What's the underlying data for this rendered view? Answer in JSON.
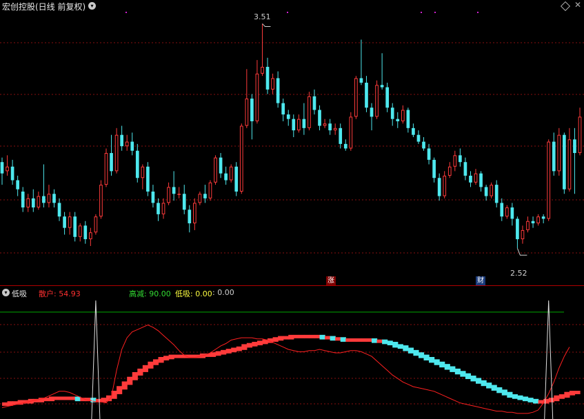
{
  "header": {
    "title": "宏创控股(日线 前复权)",
    "toggle_icon": "chevron-down-icon",
    "right_icons": [
      "diamond-icon",
      "close-icon"
    ],
    "close_glyph": "✕"
  },
  "main_chart": {
    "high_label": "3.51",
    "low_label": "2.52",
    "marker_up": "涨",
    "marker_fin": "财"
  },
  "indicator": {
    "name": "低吸",
    "items": [
      {
        "label": "散户: ",
        "value": "54.93",
        "color": "#ff3030"
      },
      {
        "label": "高减: ",
        "value": "90.00",
        "color": "#33dd33"
      },
      {
        "label": "低吸: ",
        "value": "0.00",
        "color": "#ffff40"
      },
      {
        "label": " : ",
        "value": "0.00",
        "color": "#cfcfcf"
      }
    ]
  },
  "colors": {
    "up": "#ff3b3b",
    "down": "#4ee8ee",
    "grid": "#8a1010",
    "divider": "#b00000",
    "green_line": "#00aa00",
    "white_line": "#e0e0e0",
    "red_line": "#ff2020"
  },
  "chart_data": {
    "type": "candlestick",
    "price_range": [
      2.46,
      3.56
    ],
    "candles": [
      [
        2.9,
        2.85,
        2.92,
        2.8
      ],
      [
        2.86,
        2.88,
        2.93,
        2.84
      ],
      [
        2.88,
        2.82,
        2.91,
        2.8
      ],
      [
        2.82,
        2.78,
        2.84,
        2.75
      ],
      [
        2.77,
        2.7,
        2.79,
        2.68
      ],
      [
        2.7,
        2.74,
        2.76,
        2.68
      ],
      [
        2.74,
        2.7,
        2.78,
        2.68
      ],
      [
        2.7,
        2.75,
        2.77,
        2.69
      ],
      [
        2.75,
        2.72,
        2.89,
        2.7
      ],
      [
        2.72,
        2.76,
        2.8,
        2.7
      ],
      [
        2.76,
        2.72,
        2.78,
        2.7
      ],
      [
        2.72,
        2.66,
        2.74,
        2.64
      ],
      [
        2.66,
        2.61,
        2.68,
        2.58
      ],
      [
        2.61,
        2.66,
        2.68,
        2.58
      ],
      [
        2.66,
        2.57,
        2.68,
        2.55
      ],
      [
        2.57,
        2.62,
        2.63,
        2.55
      ],
      [
        2.62,
        2.56,
        2.64,
        2.54
      ],
      [
        2.56,
        2.59,
        2.61,
        2.53
      ],
      [
        2.59,
        2.66,
        2.67,
        2.58
      ],
      [
        2.66,
        2.8,
        2.82,
        2.65
      ],
      [
        2.8,
        2.94,
        2.96,
        2.79
      ],
      [
        2.94,
        2.86,
        3.02,
        2.84
      ],
      [
        2.86,
        3.02,
        3.05,
        2.85
      ],
      [
        3.02,
        2.97,
        3.06,
        2.95
      ],
      [
        2.97,
        2.99,
        3.02,
        2.95
      ],
      [
        2.99,
        2.95,
        3.03,
        2.93
      ],
      [
        2.95,
        2.83,
        2.98,
        2.81
      ],
      [
        2.83,
        2.88,
        2.89,
        2.78
      ],
      [
        2.88,
        2.77,
        2.9,
        2.75
      ],
      [
        2.77,
        2.72,
        2.8,
        2.7
      ],
      [
        2.72,
        2.67,
        2.74,
        2.64
      ],
      [
        2.67,
        2.72,
        2.74,
        2.65
      ],
      [
        2.72,
        2.79,
        2.81,
        2.71
      ],
      [
        2.79,
        2.76,
        2.86,
        2.73
      ],
      [
        2.76,
        2.76,
        2.79,
        2.74
      ],
      [
        2.76,
        2.69,
        2.8,
        2.67
      ],
      [
        2.69,
        2.63,
        2.71,
        2.59
      ],
      [
        2.63,
        2.72,
        2.74,
        2.6
      ],
      [
        2.72,
        2.76,
        2.77,
        2.71
      ],
      [
        2.76,
        2.74,
        2.8,
        2.72
      ],
      [
        2.74,
        2.81,
        2.82,
        2.73
      ],
      [
        2.81,
        2.92,
        2.93,
        2.8
      ],
      [
        2.92,
        2.85,
        2.94,
        2.83
      ],
      [
        2.85,
        2.82,
        2.88,
        2.8
      ],
      [
        2.82,
        2.88,
        2.89,
        2.81
      ],
      [
        2.88,
        2.77,
        2.9,
        2.75
      ],
      [
        2.77,
        3.06,
        3.07,
        2.76
      ],
      [
        3.06,
        3.18,
        3.31,
        3.05
      ],
      [
        3.18,
        3.08,
        3.2,
        3.0
      ],
      [
        3.08,
        3.29,
        3.35,
        3.07
      ],
      [
        3.29,
        3.32,
        3.51,
        3.28
      ],
      [
        3.32,
        3.22,
        3.36,
        3.2
      ],
      [
        3.22,
        3.27,
        3.29,
        3.2
      ],
      [
        3.27,
        3.16,
        3.3,
        3.14
      ],
      [
        3.16,
        3.11,
        3.18,
        3.08
      ],
      [
        3.11,
        3.09,
        3.13,
        3.06
      ],
      [
        3.09,
        3.04,
        3.11,
        3.01
      ],
      [
        3.04,
        3.09,
        3.11,
        3.03
      ],
      [
        3.09,
        3.05,
        3.16,
        3.02
      ],
      [
        3.05,
        3.19,
        3.21,
        3.04
      ],
      [
        3.19,
        3.13,
        3.22,
        3.11
      ],
      [
        3.13,
        3.06,
        3.15,
        3.04
      ],
      [
        3.06,
        3.07,
        3.09,
        3.05
      ],
      [
        3.07,
        3.04,
        3.09,
        3.02
      ],
      [
        3.04,
        3.05,
        3.07,
        3.02
      ],
      [
        3.05,
        2.98,
        3.07,
        2.96
      ],
      [
        2.98,
        2.96,
        3.0,
        2.95
      ],
      [
        2.96,
        3.1,
        3.12,
        2.95
      ],
      [
        3.1,
        3.27,
        3.28,
        3.09
      ],
      [
        3.27,
        3.25,
        3.44,
        3.24
      ],
      [
        3.25,
        3.14,
        3.28,
        3.12
      ],
      [
        3.14,
        3.1,
        3.16,
        3.04
      ],
      [
        3.1,
        3.24,
        3.26,
        3.09
      ],
      [
        3.24,
        3.23,
        3.38,
        3.22
      ],
      [
        3.23,
        3.14,
        3.25,
        3.12
      ],
      [
        3.14,
        3.09,
        3.16,
        3.06
      ],
      [
        3.09,
        3.08,
        3.12,
        3.05
      ],
      [
        3.08,
        3.13,
        3.15,
        3.07
      ],
      [
        3.13,
        3.05,
        3.14,
        3.03
      ],
      [
        3.05,
        3.02,
        3.07,
        3.01
      ],
      [
        3.02,
        2.99,
        3.04,
        2.98
      ],
      [
        2.99,
        2.96,
        3.01,
        2.95
      ],
      [
        2.96,
        2.91,
        2.98,
        2.89
      ],
      [
        2.91,
        2.83,
        2.92,
        2.81
      ],
      [
        2.83,
        2.75,
        2.85,
        2.73
      ],
      [
        2.75,
        2.84,
        2.86,
        2.74
      ],
      [
        2.84,
        2.88,
        2.9,
        2.83
      ],
      [
        2.88,
        2.93,
        2.95,
        2.86
      ],
      [
        2.93,
        2.9,
        2.96,
        2.88
      ],
      [
        2.9,
        2.84,
        2.92,
        2.82
      ],
      [
        2.84,
        2.81,
        2.86,
        2.79
      ],
      [
        2.81,
        2.85,
        2.87,
        2.8
      ],
      [
        2.85,
        2.79,
        2.86,
        2.77
      ],
      [
        2.79,
        2.75,
        2.8,
        2.73
      ],
      [
        2.75,
        2.8,
        2.81,
        2.74
      ],
      [
        2.8,
        2.72,
        2.82,
        2.7
      ],
      [
        2.72,
        2.66,
        2.74,
        2.64
      ],
      [
        2.66,
        2.7,
        2.71,
        2.65
      ],
      [
        2.7,
        2.65,
        2.72,
        2.62
      ],
      [
        2.65,
        2.56,
        2.66,
        2.52
      ],
      [
        2.56,
        2.6,
        2.62,
        2.54
      ],
      [
        2.6,
        2.64,
        2.66,
        2.59
      ],
      [
        2.64,
        2.63,
        2.66,
        2.61
      ],
      [
        2.63,
        2.66,
        2.67,
        2.62
      ],
      [
        2.66,
        2.65,
        2.67,
        2.63
      ],
      [
        2.65,
        2.99,
        3.0,
        2.64
      ],
      [
        2.99,
        2.86,
        3.03,
        2.84
      ],
      [
        2.86,
        3.02,
        3.05,
        2.84
      ],
      [
        3.02,
        2.78,
        3.03,
        2.76
      ],
      [
        2.78,
        3.0,
        3.05,
        2.77
      ],
      [
        3.0,
        2.94,
        3.05,
        2.76
      ],
      [
        2.94,
        3.1,
        3.14,
        2.93
      ]
    ],
    "indicator": {
      "range": [
        0,
        100
      ],
      "ref_lines": [
        90
      ],
      "spikes": [
        18,
        105
      ],
      "curve_red": [
        8,
        9,
        10,
        11,
        12,
        13,
        14,
        15,
        16,
        18,
        20,
        22,
        22,
        21,
        19,
        17,
        15,
        14,
        13,
        13,
        12,
        17,
        40,
        58,
        68,
        73,
        75,
        77,
        79,
        77,
        74,
        70,
        66,
        62,
        57,
        53,
        51,
        51,
        52,
        53,
        55,
        58,
        61,
        63,
        66,
        67,
        68,
        68,
        68,
        67,
        67,
        66,
        64,
        62,
        60,
        58,
        57,
        56,
        56,
        57,
        57,
        58,
        57,
        56,
        55,
        55,
        56,
        57,
        57,
        56,
        54,
        52,
        48,
        44,
        40,
        36,
        33,
        30,
        28,
        26,
        25,
        24,
        23,
        22,
        20,
        18,
        16,
        14,
        12,
        11,
        10,
        9,
        8,
        7,
        6,
        5,
        5,
        4,
        4,
        3,
        3,
        3,
        4,
        6,
        12,
        20,
        30,
        42,
        52,
        60
      ],
      "band": [
        11,
        11,
        12,
        12,
        13,
        13,
        14,
        14,
        15,
        15,
        16,
        16,
        16,
        16,
        16,
        15,
        15,
        15,
        14,
        14,
        15,
        17,
        21,
        25,
        29,
        33,
        37,
        40,
        43,
        46,
        48,
        50,
        51,
        52,
        52,
        52,
        52,
        52,
        52,
        53,
        53,
        54,
        55,
        56,
        57,
        58,
        59,
        61,
        62,
        63,
        64,
        65,
        66,
        67,
        68,
        68,
        69,
        69,
        69,
        69,
        69,
        69,
        68,
        68,
        67,
        67,
        66,
        66,
        66,
        66,
        66,
        66,
        65,
        65,
        64,
        63,
        61,
        60,
        58,
        56,
        54,
        52,
        50,
        48,
        46,
        44,
        42,
        40,
        38,
        36,
        34,
        32,
        30,
        28,
        26,
        24,
        22,
        20,
        18,
        17,
        16,
        15,
        14,
        13,
        13,
        14,
        15,
        17,
        18,
        20,
        21,
        21
      ]
    }
  }
}
